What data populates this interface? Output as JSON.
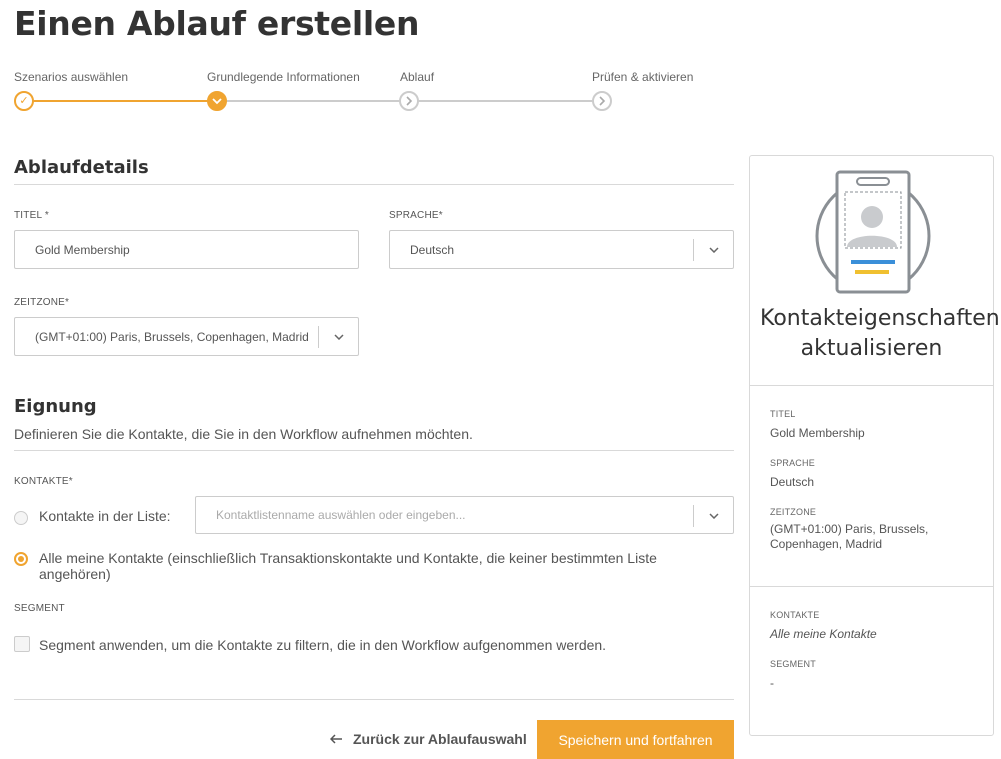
{
  "page": {
    "title": "Einen Ablauf erstellen"
  },
  "stepper": {
    "steps": [
      {
        "label": "Szenarios auswählen",
        "state": "done"
      },
      {
        "label": "Grundlegende Informationen",
        "state": "active"
      },
      {
        "label": "Ablauf",
        "state": "todo"
      },
      {
        "label": "Prüfen & aktivieren",
        "state": "todo"
      }
    ],
    "accent_color": "#f0a430",
    "inactive_color": "#cccccc"
  },
  "details": {
    "heading": "Ablaufdetails",
    "title_label": "TITEL *",
    "title_value": "Gold Membership",
    "language_label": "SPRACHE*",
    "language_value": "Deutsch",
    "timezone_label": "ZEITZONE*",
    "timezone_value": "(GMT+01:00) Paris, Brussels, Copenhagen, Madrid"
  },
  "eligibility": {
    "heading": "Eignung",
    "description": "Definieren Sie die Kontakte, die Sie in den Workflow aufnehmen möchten.",
    "contacts_label": "KONTAKTE*",
    "option_list_label": "Kontakte in der Liste:",
    "list_placeholder": "Kontaktlistenname auswählen oder eingeben...",
    "option_all_label": "Alle meine Kontakte (einschließlich Transaktionskontakte und Kontakte, die keiner bestimmten Liste angehören)",
    "segment_label": "SEGMENT",
    "segment_checkbox_label": "Segment anwenden, um die Kontakte zu filtern, die in den Workflow aufgenommen werden."
  },
  "actions": {
    "back_label": "Zurück zur Ablaufauswahl",
    "save_label": "Speichern und fortfahren"
  },
  "summary": {
    "title": "Kontakteigenschaften aktualisieren",
    "title_label": "TITEL",
    "title_value": "Gold Membership",
    "language_label": "SPRACHE",
    "language_value": "Deutsch",
    "timezone_label": "ZEITZONE",
    "timezone_value": "(GMT+01:00) Paris, Brussels, Copenhagen, Madrid",
    "contacts_label": "KONTAKTE",
    "contacts_value": "Alle meine Kontakte",
    "segment_label": "SEGMENT",
    "segment_value": "-"
  },
  "icons": {
    "step_done": "check-icon",
    "step_todo": "chevron-right-icon",
    "select": "chevron-down-icon",
    "back": "arrow-left-icon",
    "summary": "contact-card-icon"
  }
}
